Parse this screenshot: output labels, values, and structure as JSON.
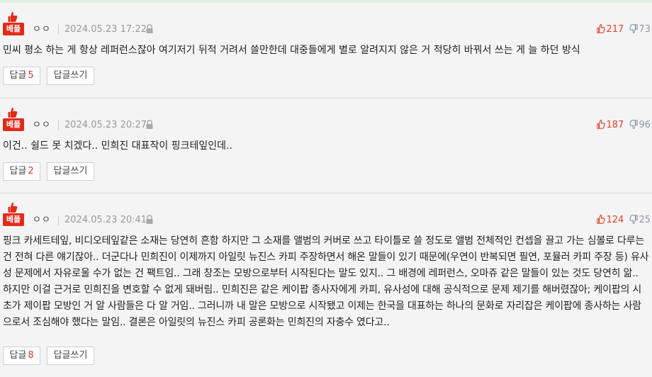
{
  "badge_label": "베플",
  "reply_label": "답글",
  "write_label": "답글쓰기",
  "colors": {
    "badge": "#e22c1a",
    "upvote": "#e0412c",
    "downvote": "#8a9aa6"
  },
  "comments": [
    {
      "nick": "ㅇㅇ",
      "date": "2024.05.23 17:22",
      "up": "217",
      "down": "73",
      "text": "민씨 평소 하는 게 항상 레퍼런스잖아 여기저기 뒤적 거려서 쓸만한데 대중들에게 별로 알려지지 않은 거 적당히 바꿔서 쓰는 게 늘 하던 방식",
      "replies": "5"
    },
    {
      "nick": "ㅇㅇ",
      "date": "2024.05.23 20:27",
      "up": "187",
      "down": "96",
      "text": "이건.. 쉴드 못 치겠다.. 민희진 대표작이 핑크테잎인데..",
      "replies": "2"
    },
    {
      "nick": "ㅇㅇ",
      "date": "2024.05.23 20:41",
      "up": "124",
      "down": "25",
      "text": "핑크 카세트테잎, 비디오테잎같은 소재는 당연히 흔함 하지만 그 소재를 앨범의 커버로 쓰고 타이틀로 쓸 정도로 앨범 전체적인 컨셉을 끌고 가는 심볼로 다루는 건 전혀 다른 얘기잖아.. 더군다나 민희진이 이제까지 아일릿 뉴진스 카피 주장하면서 해온 말들이 있기 때문에(우연이 반복되면 필연, 포뮬러 카피 주장 등) 유사성 문제에서 자유로울 수가 없는 건 팩트임.. 그래 창조는 모방으로부터 시작된다는 말도 있지.. 그 배경에 레퍼런스, 오마쥬 같은 말들이 있는 것도 당연히 앎.. 하지만 이걸 근거로 민희진을 변호할 수 없게 돼버림.. 민희진은 같은 케이팝 종사자에게 카피, 유사성에 대해 공식적으로 문제 제기를 해버렸잖아; 케이팝의 시초가 제이팝 모방인 거 알 사람들은 다 알 거임.. 그러니까 내 말은 모방으로 시작됐고 이제는 한국을 대표하는 하나의 문화로 자리잡은 케이팝에 종사하는 사람으로서 조심해야 했다는 말임.. 결론은 아일릿의 뉴진스 카피 공론화는 민희진의 자충수 였다고..",
      "replies": "8"
    }
  ]
}
